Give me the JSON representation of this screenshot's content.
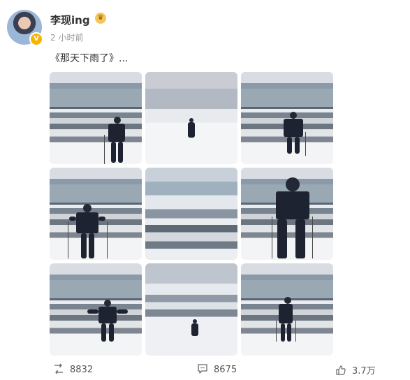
{
  "post": {
    "username": "李现ing",
    "timestamp": "2 小时前",
    "text": "《那天下雨了》...",
    "photos_count": 9
  },
  "stats": {
    "reposts": "8832",
    "comments": "8675",
    "likes": "3.7万"
  },
  "icons": {
    "repost": "repost-icon",
    "comment": "comment-icon",
    "like": "like-icon",
    "verified": "verified-badge-icon",
    "crown": "crown-icon"
  },
  "colors": {
    "text": "#333333",
    "muted": "#999999",
    "badge": "#f6b400"
  }
}
